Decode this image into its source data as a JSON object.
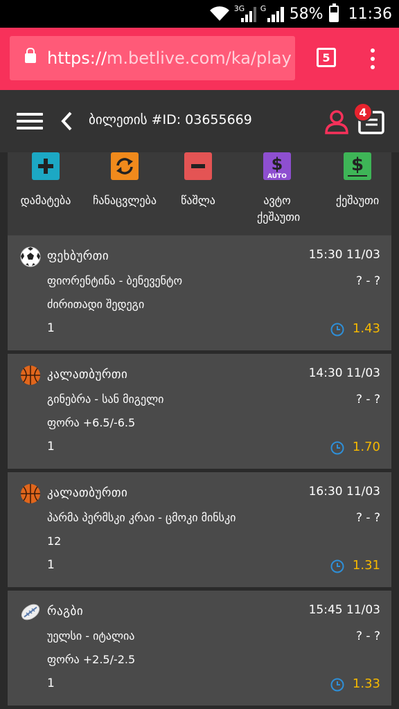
{
  "status_bar": {
    "network_1": "3G",
    "network_2": "G",
    "battery": "58%",
    "time": "11:36"
  },
  "browser": {
    "url_scheme": "https://",
    "url_rest": "m.betlive.com/ka/play",
    "tab_count": "5"
  },
  "header": {
    "title": "ბილეთის #ID: 03655669",
    "badge_count": "4"
  },
  "actions": [
    {
      "label": "დამატება",
      "icon": "plus-icon",
      "color": "#1ca8c4"
    },
    {
      "label": "ჩანაცვლება",
      "icon": "swap-icon",
      "color": "#f08a1c"
    },
    {
      "label": "წაშლა",
      "icon": "minus-icon",
      "color": "#e45454"
    },
    {
      "label": "ავტო ქეშაუთი",
      "icon": "auto-cashout-icon",
      "color": "#8e4fd0"
    },
    {
      "label": "ქეშაუთი",
      "icon": "cashout-icon",
      "color": "#3eb557"
    }
  ],
  "auto_text": "AUTO",
  "bets": [
    {
      "sport": "ფეხბურთი",
      "sport_icon": "soccer-ball-icon",
      "time": "15:30 11/03",
      "match": "ფიორენტინა - ბენევენტო",
      "score": "? - ?",
      "market": "ძირითადი შედეგი",
      "pick": "1",
      "odds": "1.43"
    },
    {
      "sport": "კალათბურთი",
      "sport_icon": "basketball-icon",
      "time": "14:30 11/03",
      "match": "გინებრა - სან მიგელი",
      "score": "? - ?",
      "market": "ფორა +6.5/-6.5",
      "pick": "1",
      "odds": "1.70"
    },
    {
      "sport": "კალათბურთი",
      "sport_icon": "basketball-icon",
      "time": "16:30 11/03",
      "match": "პარმა პერმსკი კრაი - ცმოკი მინსკი",
      "score": "? - ?",
      "market": "12",
      "pick": "1",
      "odds": "1.31"
    },
    {
      "sport": "რაგბი",
      "sport_icon": "rugby-ball-icon",
      "time": "15:45 11/03",
      "match": "უელსი - იტალია",
      "score": "? - ?",
      "market": "ფორა +2.5/-2.5",
      "pick": "1",
      "odds": "1.33"
    }
  ]
}
